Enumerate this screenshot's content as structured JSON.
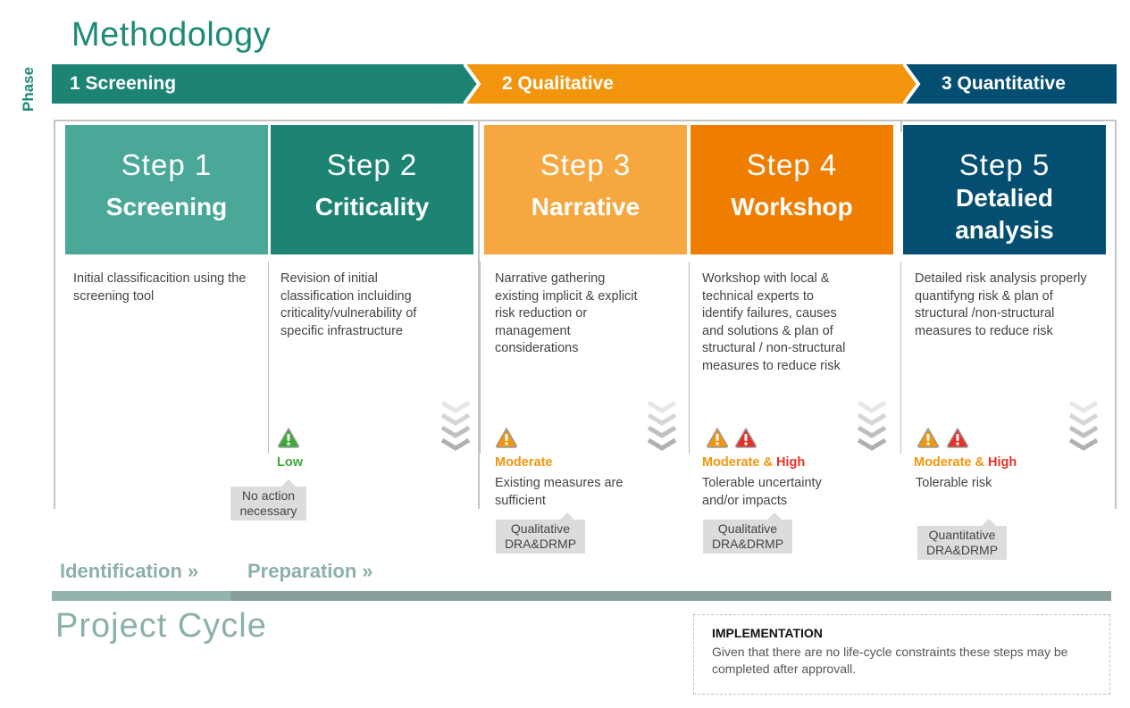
{
  "title": "Methodology",
  "phase_axis_label": "Phase",
  "phases": [
    {
      "number": "1",
      "label": "Screening",
      "color": "#1d8474"
    },
    {
      "number": "2",
      "label": "Qualitative",
      "color": "#f2950c"
    },
    {
      "number": "3",
      "label": "Quantitative",
      "color": "#044f71"
    }
  ],
  "steps": [
    {
      "step": "Step 1",
      "name": "Screening",
      "color": "#4aa898",
      "description": "Initial classificacition using the screening tool"
    },
    {
      "step": "Step 2",
      "name": "Criticality",
      "color": "#1d8474",
      "description": "Revision of initial classification incluiding criticality/vulnerability of specific infrastructure",
      "risk": {
        "icons": [
          "warning-green"
        ],
        "label_parts": [
          {
            "text": "Low",
            "color": "#3aaa35"
          }
        ],
        "note": ""
      },
      "tag": "No action necessary"
    },
    {
      "step": "Step 3",
      "name": "Narrative",
      "color": "#f6a73f",
      "description": "Narrative gathering existing implicit & explicit risk reduction or management considerations",
      "risk": {
        "icons": [
          "warning-orange"
        ],
        "label_parts": [
          {
            "text": "Moderate",
            "color": "#f2950c"
          }
        ],
        "note": "Existing measures are sufficient"
      },
      "tag": "Qualitative DRA&DRMP"
    },
    {
      "step": "Step 4",
      "name": "Workshop",
      "color": "#ef7d00",
      "description": "Workshop with local & technical experts to identify failures, causes and solutions & plan of structural / non-structural measures to reduce risk",
      "risk": {
        "icons": [
          "warning-orange",
          "warning-red"
        ],
        "label_parts": [
          {
            "text": "Moderate & ",
            "color": "#f2950c"
          },
          {
            "text": "High",
            "color": "#e63027"
          }
        ],
        "note": "Tolerable uncertainty and/or impacts"
      },
      "tag": "Qualitative DRA&DRMP"
    },
    {
      "step": "Step 5",
      "name": "Detalied analysis",
      "color": "#044f71",
      "description": "Detailed risk analysis properly quantifyng risk & plan of structural /non-structural measures to reduce risk",
      "risk": {
        "icons": [
          "warning-orange",
          "warning-red"
        ],
        "label_parts": [
          {
            "text": "Moderate & ",
            "color": "#f2950c"
          },
          {
            "text": "High",
            "color": "#e63027"
          }
        ],
        "note": "Tolerable risk"
      },
      "tag": "Quantitative DRA&DRMP"
    }
  ],
  "project_cycle": {
    "title": "Project Cycle",
    "stages": [
      "Identification",
      "Preparation"
    ],
    "arrow_glyph": "»"
  },
  "implementation": {
    "title": "IMPLEMENTATION",
    "text": "Given that there are no life-cycle constraints these steps may be completed after approvall."
  }
}
